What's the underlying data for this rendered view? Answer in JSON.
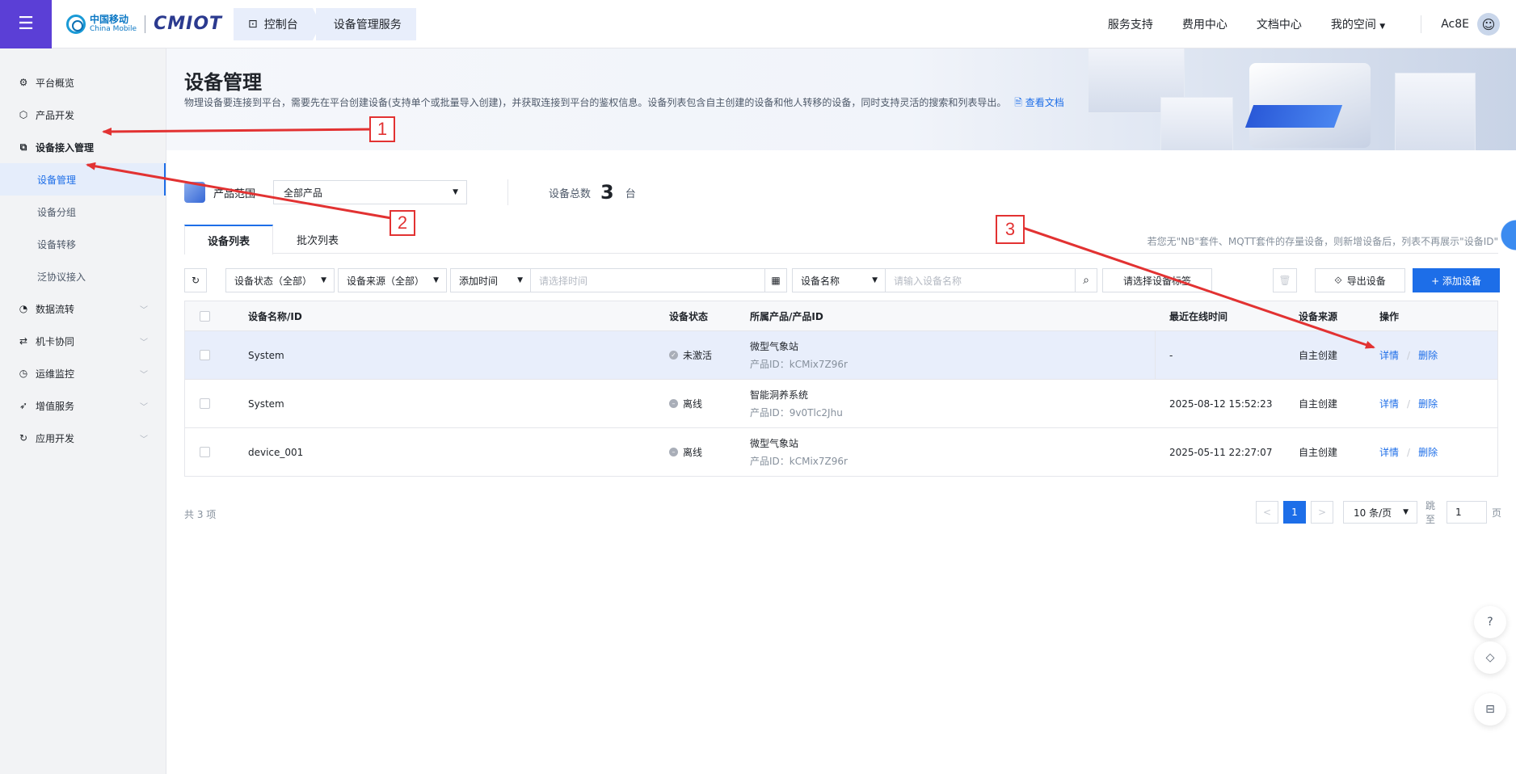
{
  "header": {
    "menu_icon": "hamburger-menu-icon",
    "logo_cn": "中国移动",
    "logo_en": "China Mobile",
    "brand": "CMIOT",
    "breadcrumb": [
      "控制台",
      "设备管理服务"
    ],
    "nav": [
      "服务支持",
      "费用中心",
      "文档中心",
      "我的空间"
    ],
    "user": "Ac8E"
  },
  "sidebar": {
    "items": [
      {
        "label": "平台概览",
        "icon": "overview-icon"
      },
      {
        "label": "产品开发",
        "icon": "cube-icon"
      },
      {
        "label": "设备接入管理",
        "icon": "device-access-icon"
      }
    ],
    "sub_items": [
      {
        "label": "设备管理"
      },
      {
        "label": "设备分组"
      },
      {
        "label": "设备转移"
      },
      {
        "label": "泛协议接入"
      }
    ],
    "more_items": [
      {
        "label": "数据流转",
        "icon": "data-flow-icon"
      },
      {
        "label": "机卡协同",
        "icon": "card-sync-icon"
      },
      {
        "label": "运维监控",
        "icon": "monitor-icon"
      },
      {
        "label": "增值服务",
        "icon": "value-added-icon"
      },
      {
        "label": "应用开发",
        "icon": "app-dev-icon"
      }
    ]
  },
  "banner": {
    "title": "设备管理",
    "desc": "物理设备要连接到平台，需要先在平台创建设备(支持单个或批量导入创建)，并获取连接到平台的鉴权信息。设备列表包含自主创建的设备和他人转移的设备，同时支持灵活的搜索和列表导出。",
    "doc_link": "查看文档"
  },
  "filter": {
    "product_label": "产品范围",
    "product_value": "全部产品",
    "count_label": "设备总数",
    "count_value": "3",
    "count_unit": "台"
  },
  "tabs": {
    "items": [
      "设备列表",
      "批次列表"
    ],
    "note": "若您无\"NB\"套件、MQTT套件的存量设备，则新增设备后，列表不再展示\"设备ID\""
  },
  "toolbar": {
    "status_filter": "设备状态（全部）",
    "source_filter": "设备来源（全部）",
    "time_filter": "添加时间",
    "time_placeholder": "请选择时间",
    "name_filter": "设备名称",
    "name_placeholder": "请输入设备名称",
    "tag_filter": "请选择设备标签",
    "export_label": "导出设备",
    "add_label": "+ 添加设备"
  },
  "table": {
    "columns": [
      "设备名称/ID",
      "设备状态",
      "所属产品/产品ID",
      "最近在线时间",
      "设备来源",
      "操作"
    ],
    "rows": [
      {
        "name": "System",
        "status": "未激活",
        "product": "微型气象站",
        "product_id": "产品ID：kCMix7Z96r",
        "last_online": "-",
        "source": "自主创建",
        "detail": "详情",
        "delete": "删除"
      },
      {
        "name": "System",
        "status": "离线",
        "product": "智能洞养系统",
        "product_id": "产品ID：9v0Tlc2Jhu",
        "last_online": "2025-08-12 15:52:23",
        "source": "自主创建",
        "detail": "详情",
        "delete": "删除"
      },
      {
        "name": "device_001",
        "status": "离线",
        "product": "微型气象站",
        "product_id": "产品ID：kCMix7Z96r",
        "last_online": "2025-05-11 22:27:07",
        "source": "自主创建",
        "detail": "详情",
        "delete": "删除"
      }
    ],
    "slash": "/"
  },
  "pagination": {
    "total": "共 3 项",
    "prev": "<",
    "current_page": "1",
    "next": ">",
    "page_size": "10 条/页",
    "jump_label": "跳至",
    "jump_value": "1",
    "jump_unit": "页"
  },
  "annotations": [
    "1",
    "2",
    "3"
  ],
  "colors": {
    "accent": "#1d6ee8",
    "menu_bg": "#5b3fd6",
    "annotation": "#e23232"
  }
}
